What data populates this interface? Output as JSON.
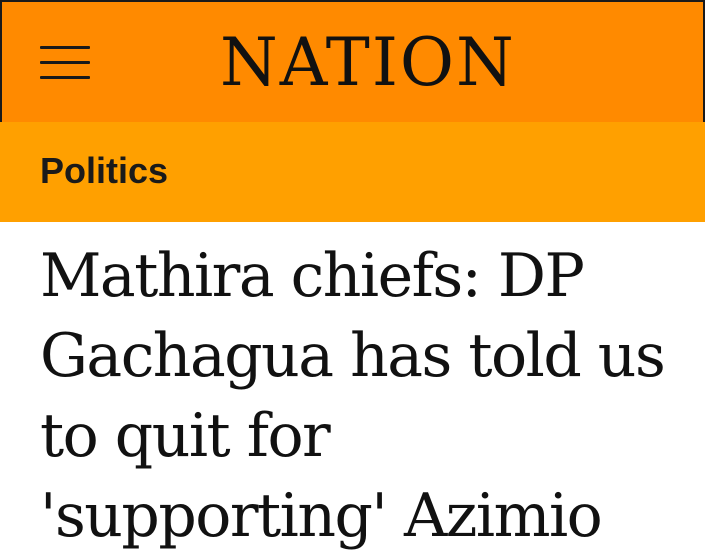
{
  "header": {
    "brand": "NATION",
    "menu_icon": "hamburger-menu-icon",
    "background_color": "#ff8a00"
  },
  "section": {
    "label": "Politics",
    "background_color": "#ffa000"
  },
  "article": {
    "headline": "Mathira chiefs: DP Gachagua has told us to quit for 'supporting' Azimio"
  }
}
